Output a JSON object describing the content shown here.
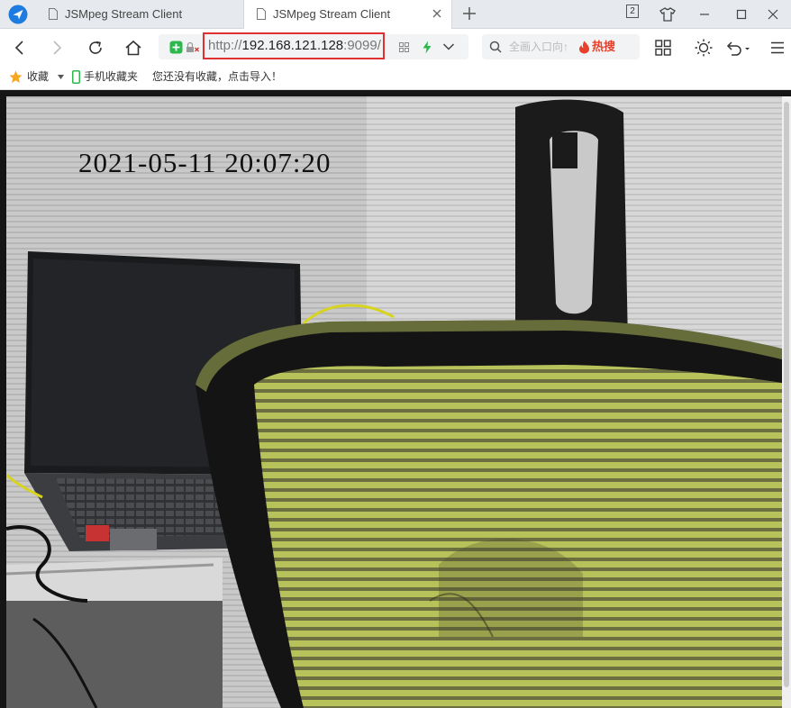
{
  "tabs": [
    {
      "title": "JSMpeg Stream Client"
    },
    {
      "title": "JSMpeg Stream Client"
    }
  ],
  "window": {
    "tab_count_badge": "2"
  },
  "address": {
    "protocol": "http://",
    "host": "192.168.121.128",
    "port": ":9099/"
  },
  "search": {
    "placeholder": "全画入口向↑",
    "hot_label": "热搜"
  },
  "bookmarks": {
    "favorites_label": "收藏",
    "mobile_label": "手机收藏夹",
    "empty_hint": "您还没有收藏，点击导入！"
  },
  "video": {
    "osd_timestamp": "2021-05-11 20:07:20"
  },
  "colors": {
    "highlight_border": "#e03131",
    "hot": "#e8412b",
    "shield": "#2db84d"
  }
}
